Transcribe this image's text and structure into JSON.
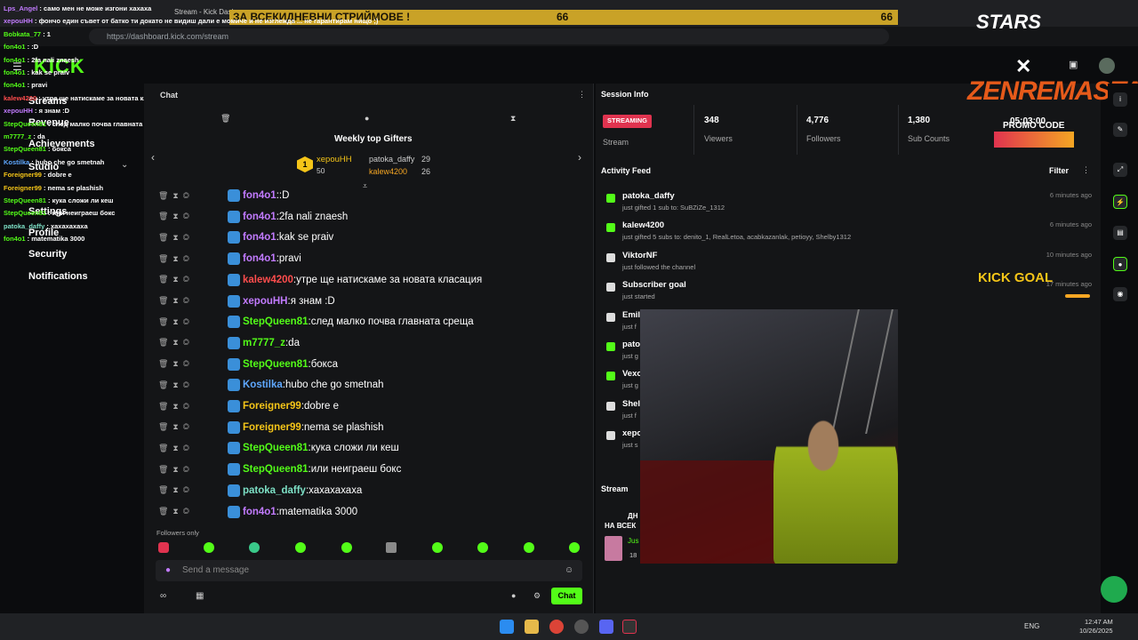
{
  "browser": {
    "tab_title": "Stream - Kick Dash",
    "url": "https://dashboard.kick.com/stream"
  },
  "banner": {
    "text": "ЗА ВСЕКИДНЕВНИ СТРИЙМОВЕ !",
    "num1": "66",
    "num2": "66"
  },
  "ticker": [
    {
      "user": "Lps_Angel",
      "text": "само мен не може изгони хахаха",
      "color": "#c27bff"
    },
    {
      "user": "xepouHH",
      "text": "фончо един съвет от батко ти докато не видиш дали е момиче и не изглежда ... не гарантирам нищо ;)",
      "color": "#c27bff"
    },
    {
      "user": "Bobkata_77",
      "text": "1",
      "color": "#53fc18"
    },
    {
      "user": "fon4o1",
      "text": ":D",
      "color": "#53fc18"
    },
    {
      "user": "fon4o1",
      "text": "2fa nali znaesh",
      "color": "#53fc18"
    },
    {
      "user": "fon4o1",
      "text": "kak se praiv",
      "color": "#53fc18"
    },
    {
      "user": "fon4o1",
      "text": "pravi",
      "color": "#53fc18"
    },
    {
      "user": "kalew4200",
      "text": "утре ще натискаме за новата класация",
      "color": "#ff4d4d"
    },
    {
      "user": "xepouHH",
      "text": "я знам :D",
      "color": "#c27bff"
    },
    {
      "user": "StepQueen81",
      "text": "след малко почва главната среща",
      "color": "#53fc18"
    },
    {
      "user": "m7777_z",
      "text": "da",
      "color": "#53fc18"
    },
    {
      "user": "StepQueen81",
      "text": "бокса",
      "color": "#53fc18"
    },
    {
      "user": "Kostilka",
      "text": "hubo che go smetnah",
      "color": "#5fa8ff"
    },
    {
      "user": "Foreigner99",
      "text": "dobre e",
      "color": "#f5c518"
    },
    {
      "user": "Foreigner99",
      "text": "nema se plashish",
      "color": "#f5c518"
    },
    {
      "user": "StepQueen81",
      "text": "кука сложи ли кеш",
      "color": "#53fc18"
    },
    {
      "user": "StepQueen81",
      "text": "или неиграеш бокс",
      "color": "#53fc18"
    },
    {
      "user": "patoka_daffy",
      "text": "хахахахаха",
      "color": "#7de0c6"
    },
    {
      "user": "fon4o1",
      "text": "matematika 3000",
      "color": "#53fc18"
    }
  ],
  "nav": {
    "logo": "KICK",
    "items": [
      "Streams",
      "Revenue",
      "Achievements",
      "Studio",
      "Settings",
      "Profile",
      "Security",
      "Notifications"
    ]
  },
  "chat": {
    "title": "Chat",
    "gifters_title": "Weekly top Gifters",
    "gifters": [
      {
        "name": "xepouHH",
        "count": "50",
        "rank": "1"
      },
      {
        "name": "patoka_daffy",
        "count": "29"
      },
      {
        "name": "kalew4200",
        "count": "26"
      }
    ],
    "messages": [
      {
        "user": "fon4o1",
        "text": ":D",
        "color": "#c27bff"
      },
      {
        "user": "fon4o1",
        "text": "2fa nali znaesh",
        "color": "#c27bff"
      },
      {
        "user": "fon4o1",
        "text": "kak se praiv",
        "color": "#c27bff"
      },
      {
        "user": "fon4o1",
        "text": "pravi",
        "color": "#c27bff"
      },
      {
        "user": "kalew4200",
        "text": "утре ще натискаме за новата класация",
        "color": "#ff4d4d"
      },
      {
        "user": "xepouHH",
        "text": "я знам :D",
        "color": "#c27bff"
      },
      {
        "user": "StepQueen81",
        "text": "след малко почва главната среща",
        "color": "#53fc18"
      },
      {
        "user": "m7777_z",
        "text": "da",
        "color": "#53fc18"
      },
      {
        "user": "StepQueen81",
        "text": "бокса",
        "color": "#53fc18"
      },
      {
        "user": "Kostilka",
        "text": "hubo che go smetnah",
        "color": "#5fa8ff"
      },
      {
        "user": "Foreigner99",
        "text": "dobre e",
        "color": "#f5c518"
      },
      {
        "user": "Foreigner99",
        "text": "nema se plashish",
        "color": "#f5c518"
      },
      {
        "user": "StepQueen81",
        "text": "кука сложи ли кеш",
        "color": "#53fc18"
      },
      {
        "user": "StepQueen81",
        "text": "или неиграеш бокс",
        "color": "#53fc18"
      },
      {
        "user": "patoka_daffy",
        "text": "хахахахаха",
        "color": "#7de0c6"
      },
      {
        "user": "fon4o1",
        "text": "matematika 3000",
        "color": "#c27bff"
      }
    ],
    "followers_only": "Followers only",
    "input_placeholder": "Send a message",
    "send_label": "Chat"
  },
  "session": {
    "title": "Session Info",
    "status": "STREAMING",
    "status_label": "Stream",
    "stats": [
      {
        "value": "348",
        "label": "Viewers"
      },
      {
        "value": "4,776",
        "label": "Followers"
      },
      {
        "value": "1,380",
        "label": "Sub Counts"
      }
    ],
    "timer": "05:03:00"
  },
  "activity": {
    "title": "Activity Feed",
    "filter": "Filter",
    "items": [
      {
        "name": "patoka_daffy",
        "sub": "just gifted 1 sub to: SuBZiZe_1312",
        "time": "6 minutes ago"
      },
      {
        "name": "kalew4200",
        "sub": "just gifted 5 subs to: denito_1, RealLetoa, acabkazanlak, petioyy, Shelby1312",
        "time": "6 minutes ago"
      },
      {
        "name": "ViktorNF",
        "sub": "just followed the channel",
        "time": "10 minutes ago"
      },
      {
        "name": "Subscriber goal",
        "sub": "just started",
        "time": "17 minutes ago"
      },
      {
        "name": "Emil",
        "sub": "just f",
        "time": ""
      },
      {
        "name": "patol",
        "sub": "just g",
        "time": ""
      },
      {
        "name": "Vexo",
        "sub": "just g",
        "time": ""
      },
      {
        "name": "Shell",
        "sub": "just f",
        "time": ""
      },
      {
        "name": "xepo",
        "sub": "just s",
        "time": ""
      }
    ]
  },
  "stream_panel": {
    "title": "Stream",
    "line1": "ДН",
    "line2": "НА ВСЕК",
    "user": "Jus",
    "count": "18"
  },
  "overlay": {
    "stars": "STARS",
    "brand": "ZENREMASTA",
    "promo": "PROMO CODE",
    "kick_goal": "KICK GOAL"
  },
  "taskbar": {
    "lang": "ENG",
    "time": "12:47 AM",
    "date": "10/26/2025"
  }
}
